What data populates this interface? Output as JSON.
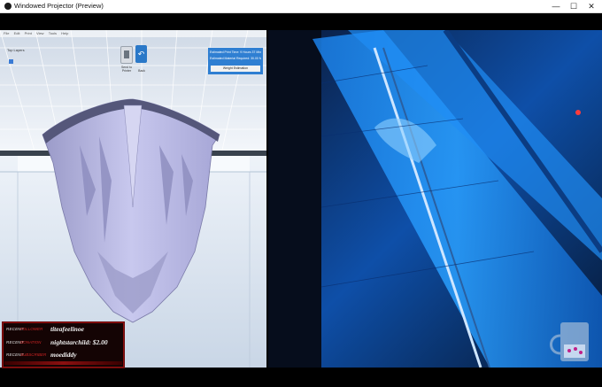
{
  "window": {
    "title": "Windowed Projector (Preview)",
    "minimize_glyph": "—",
    "maximize_glyph": "☐",
    "close_glyph": "✕"
  },
  "slicer": {
    "menu_items": [
      "File",
      "Edit",
      "Print",
      "View",
      "Tools",
      "Help"
    ],
    "layer_label": "Top Layers",
    "send_label": "Send to Printer",
    "back_label": "Back",
    "back_icon": "undo-arrow-icon",
    "estimate_print_time": "Estimated Print Time: 9 Hours 37 Minutes",
    "estimate_resin": "Estimated Material Required: 30.00 Metres",
    "weight_button": "Weight Estimation",
    "model_color": "#b8b8e6",
    "accent": "#2f7fd2"
  },
  "donations": {
    "rows": [
      {
        "tag": "RECENT",
        "type": "FOLLOWER",
        "name": "titeafeelinoe"
      },
      {
        "tag": "RECENT",
        "type": "DONATION",
        "name": "nightstarchild: $2.00"
      },
      {
        "tag": "RECENT",
        "type": "SUBSCRIBER",
        "name": "moediddy"
      }
    ]
  },
  "camera": {
    "description_icon": "mug-icon"
  }
}
